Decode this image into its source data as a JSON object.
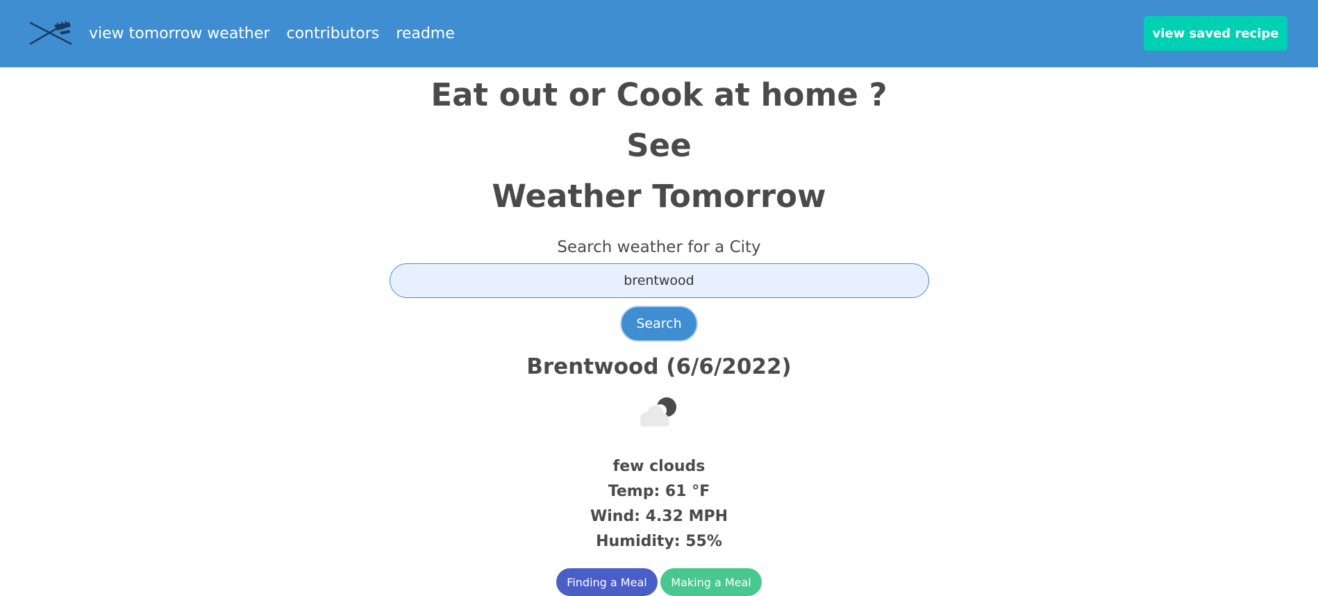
{
  "nav": {
    "links": [
      "view tomorrow weather",
      "contributors",
      "readme"
    ],
    "saved_recipe_label": "view saved recipe"
  },
  "hero": {
    "title_line1": "Eat out or Cook at home ? See",
    "title_line2": "Weather Tomorrow"
  },
  "search": {
    "label": "Search weather for a City",
    "value": "brentwood",
    "button_label": "Search"
  },
  "weather": {
    "city_header": "Brentwood (6/6/2022)",
    "icon": "few-clouds-night-icon",
    "description": "few clouds",
    "temp": "Temp: 61 °F",
    "wind": "Wind: 4.32 MPH",
    "humidity": "Humidity: 55%"
  },
  "meal_buttons": {
    "finding_label": "Finding a Meal",
    "making_label": "Making a Meal"
  },
  "colors": {
    "navbar": "#3f8ed2",
    "accent_teal": "#00d1b2",
    "finding_button": "#4a5ec8",
    "making_button": "#48c78e"
  }
}
